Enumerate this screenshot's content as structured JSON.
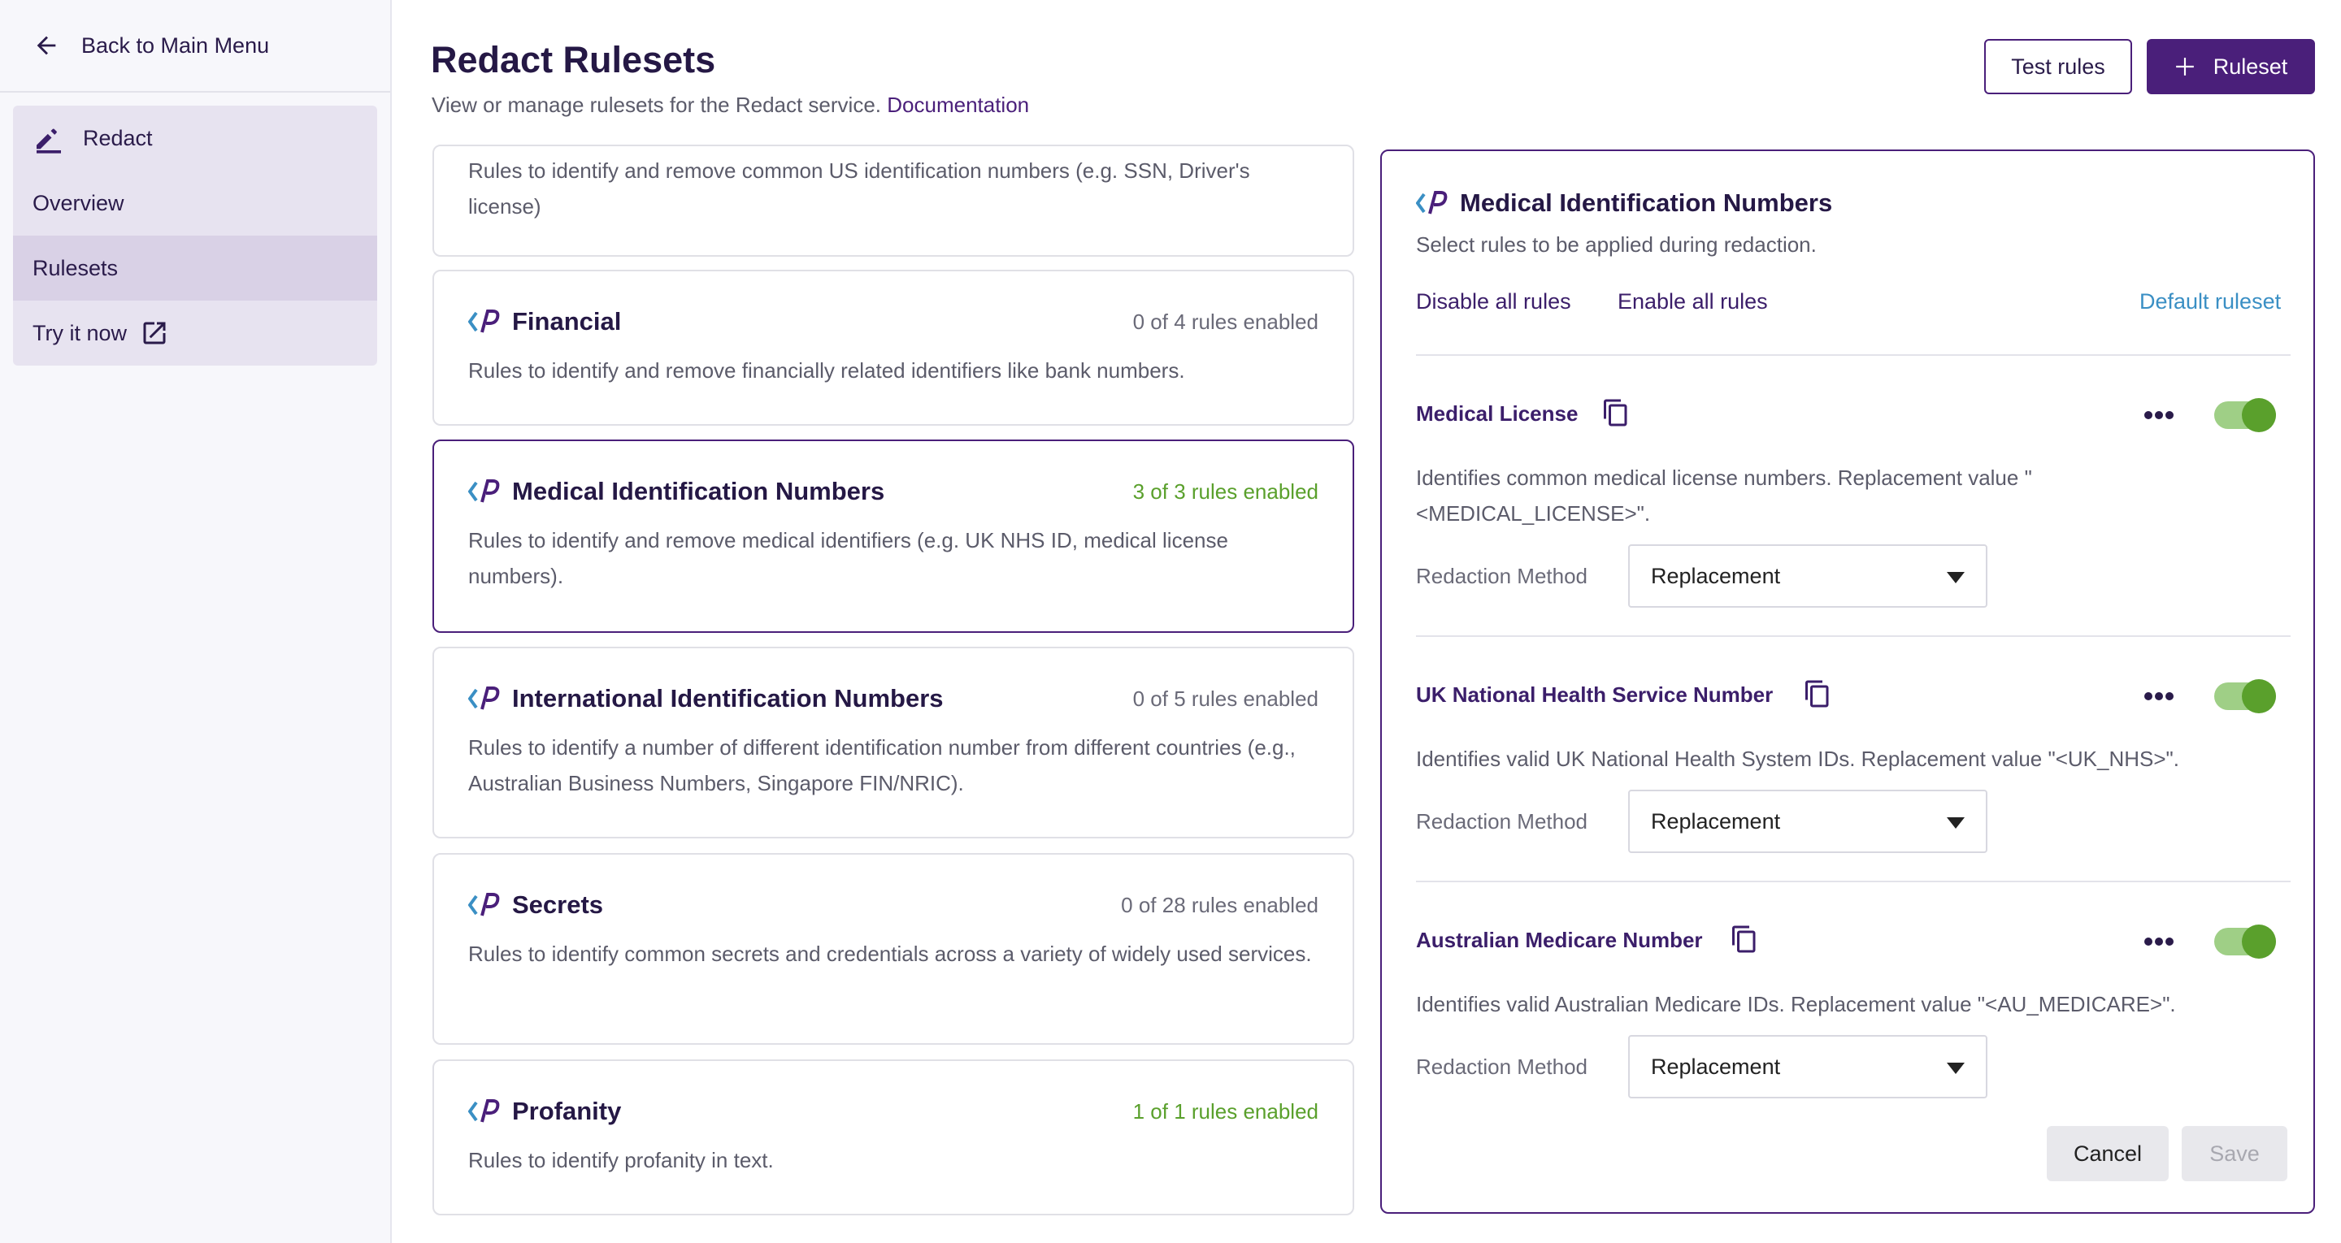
{
  "sidebar": {
    "back_label": "Back to Main Menu",
    "section_label": "Redact",
    "items": [
      {
        "label": "Overview"
      },
      {
        "label": "Rulesets",
        "selected": true
      },
      {
        "label": "Try it now"
      }
    ]
  },
  "header": {
    "title": "Redact Rulesets",
    "subtitle": "View or manage rulesets for the Redact service.",
    "doc_link": "Documentation",
    "test_rules_label": "Test rules",
    "add_ruleset_label": "Ruleset"
  },
  "rulesets": [
    {
      "name": "",
      "count": "",
      "desc": "Rules to identify and remove common US identification numbers (e.g. SSN, Driver's license)"
    },
    {
      "name": "Financial",
      "count": "0 of 4 rules enabled",
      "desc": "Rules to identify and remove financially related identifiers like bank numbers."
    },
    {
      "name": "Medical Identification Numbers",
      "count": "3 of 3 rules enabled",
      "desc": "Rules to identify and remove medical identifiers (e.g. UK NHS ID, medical license numbers).",
      "selected": true
    },
    {
      "name": "International Identification Numbers",
      "count": "0 of 5 rules enabled",
      "desc": "Rules to identify a number of different identification number from different countries (e.g., Australian Business Numbers, Singapore FIN/NRIC)."
    },
    {
      "name": "Secrets",
      "count": "0 of 28 rules enabled",
      "desc": "Rules to identify common secrets and credentials across a variety of widely used services."
    },
    {
      "name": "Profanity",
      "count": "1 of 1 rules enabled",
      "desc": "Rules to identify profanity in text."
    }
  ],
  "panel": {
    "title": "Medical Identification Numbers",
    "subtitle": "Select rules to be applied during redaction.",
    "disable_all": "Disable all rules",
    "enable_all": "Enable all rules",
    "default_ruleset": "Default ruleset",
    "method_label": "Redaction Method",
    "rules": [
      {
        "name": "Medical License",
        "desc": "Identifies common medical license numbers. Replacement value \"<MEDICAL_LICENSE>\".",
        "method": "Replacement",
        "enabled": true
      },
      {
        "name": "UK National Health Service Number",
        "desc": "Identifies valid UK National Health System IDs. Replacement value \"<UK_NHS>\".",
        "method": "Replacement",
        "enabled": true
      },
      {
        "name": "Australian Medicare Number",
        "desc": "Identifies valid Australian Medicare IDs. Replacement value \"<AU_MEDICARE>\".",
        "method": "Replacement",
        "enabled": true
      }
    ],
    "cancel_label": "Cancel",
    "save_label": "Save"
  },
  "colors": {
    "brand": "#4a1f7a",
    "enabled_green": "#5aa02c",
    "link_blue": "#3a8fc4"
  }
}
